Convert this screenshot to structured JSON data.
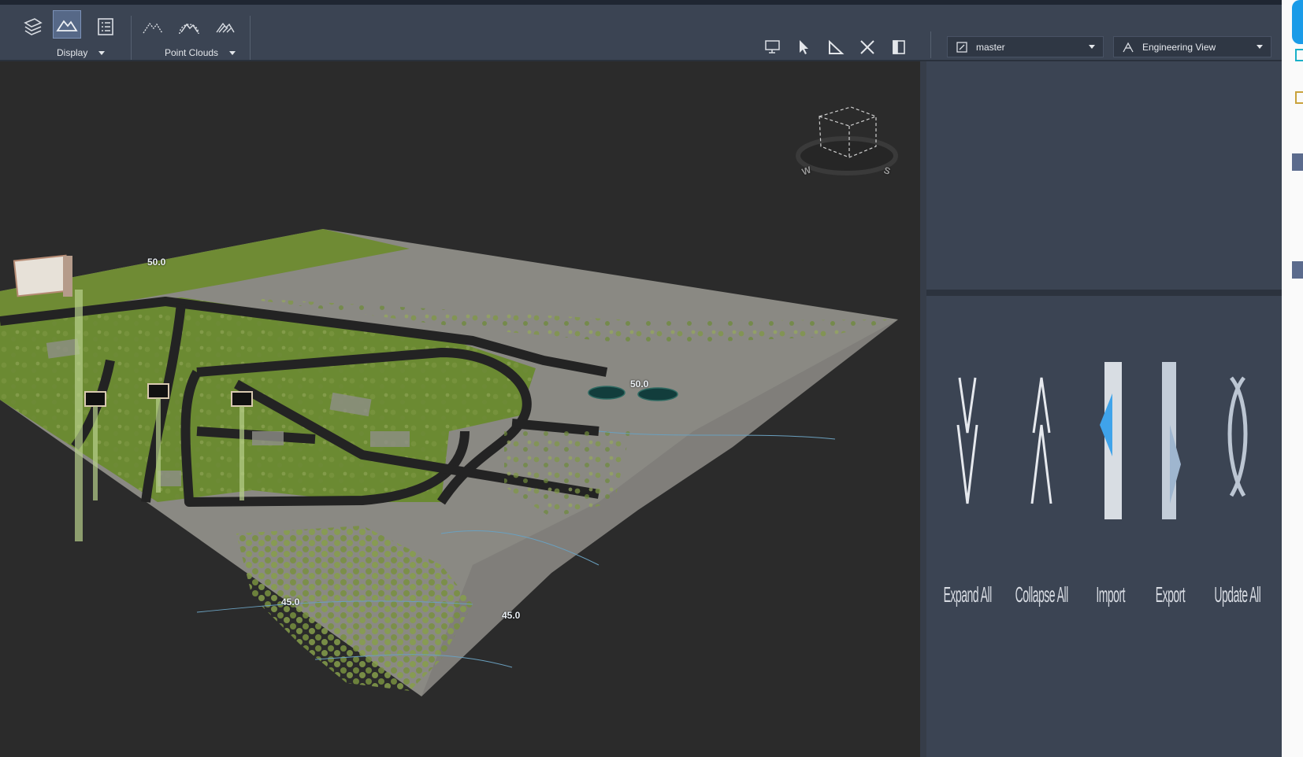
{
  "toolbar": {
    "groups": [
      {
        "label": "Display"
      },
      {
        "label": "Point Clouds"
      }
    ],
    "branch_dropdown": {
      "value": "master"
    },
    "view_dropdown": {
      "value": "Engineering View"
    }
  },
  "viewport": {
    "contour_labels": [
      "50.0",
      "50.0",
      "45.0",
      "45.0"
    ],
    "compass": {
      "w": "W",
      "s": "S"
    }
  },
  "panel": {
    "buttons": [
      {
        "label": "Expand All",
        "icon": "expand-all-icon"
      },
      {
        "label": "Collapse All",
        "icon": "collapse-all-icon"
      },
      {
        "label": "Import",
        "icon": "import-icon"
      },
      {
        "label": "Export",
        "icon": "export-icon"
      },
      {
        "label": "Update All",
        "icon": "update-all-icon"
      }
    ]
  },
  "colors": {
    "toolbar_bg": "#3b4453",
    "viewport_bg": "#2b2b2b",
    "grass": "#6b8a32",
    "terrain": "#8c8a84",
    "road": "#232323",
    "accent": "#566887"
  }
}
